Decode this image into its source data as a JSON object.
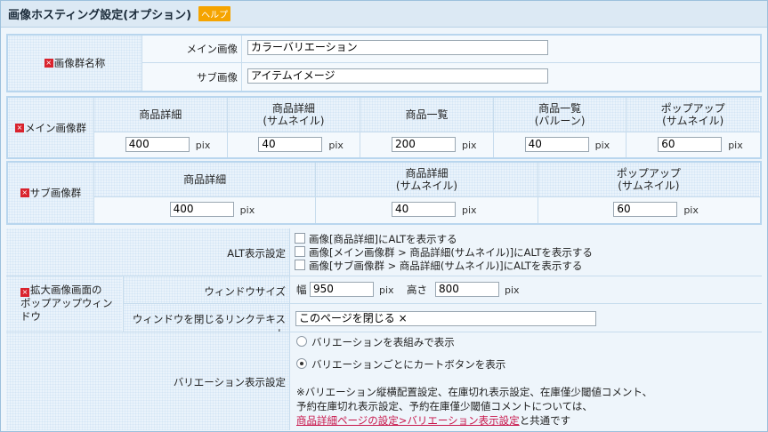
{
  "header": {
    "title": "画像ホスティング設定(オプション)",
    "help_label": "ヘルプ"
  },
  "image_group_name": {
    "label": "画像群名称",
    "main_label": "メイン画像",
    "main_value": "カラーバリエーション",
    "sub_label": "サブ画像",
    "sub_value": "アイテムイメージ"
  },
  "main_group": {
    "label": "メイン画像群",
    "columns": [
      {
        "line1": "商品詳細",
        "line2": "",
        "value": "400"
      },
      {
        "line1": "商品詳細",
        "line2": "(サムネイル)",
        "value": "40"
      },
      {
        "line1": "商品一覧",
        "line2": "",
        "value": "200"
      },
      {
        "line1": "商品一覧",
        "line2": "(バルーン)",
        "value": "40"
      },
      {
        "line1": "ポップアップ",
        "line2": "(サムネイル)",
        "value": "60"
      }
    ],
    "unit": "pix"
  },
  "sub_group": {
    "label": "サブ画像群",
    "columns": [
      {
        "line1": "商品詳細",
        "line2": "",
        "value": "400"
      },
      {
        "line1": "商品詳細",
        "line2": "(サムネイル)",
        "value": "40"
      },
      {
        "line1": "ポップアップ",
        "line2": "(サムネイル)",
        "value": "60"
      }
    ],
    "unit": "pix"
  },
  "popup": {
    "section_line1": "拡大画像画面の",
    "section_line2": "ポップアップウィンドウ",
    "alt_label": "ALT表示設定",
    "alt_options": [
      "画像[商品詳細]にALTを表示する",
      "画像[メイン画像群 > 商品詳細(サムネイル)]にALTを表示する",
      "画像[サブ画像群 > 商品詳細(サムネイル)]にALTを表示する"
    ],
    "window_size_label": "ウィンドウサイズ",
    "width_label": "幅",
    "width_value": "950",
    "height_label": "高さ",
    "height_value": "800",
    "unit": "pix",
    "close_link_label": "ウィンドウを閉じるリンクテキスト",
    "close_link_value": "このページを閉じる ×"
  },
  "variation": {
    "label": "バリエーション表示設定",
    "option1": "バリエーションを表組みで表示",
    "option2": "バリエーションごとにカートボタンを表示",
    "selected": 2,
    "note_line1": "※バリエーション縦横配置設定、在庫切れ表示設定、在庫僅少閾値コメント、",
    "note_line2": "予約在庫切れ表示設定、予約在庫僅少閾値コメントについては、",
    "note_link": "商品詳細ページの設定>バリエーション表示設定",
    "note_suffix": "と共通です"
  },
  "colors": {
    "required": "#d9232d",
    "help": "#f5a400",
    "link": "#c8164b",
    "border": "#b9d6ee"
  }
}
